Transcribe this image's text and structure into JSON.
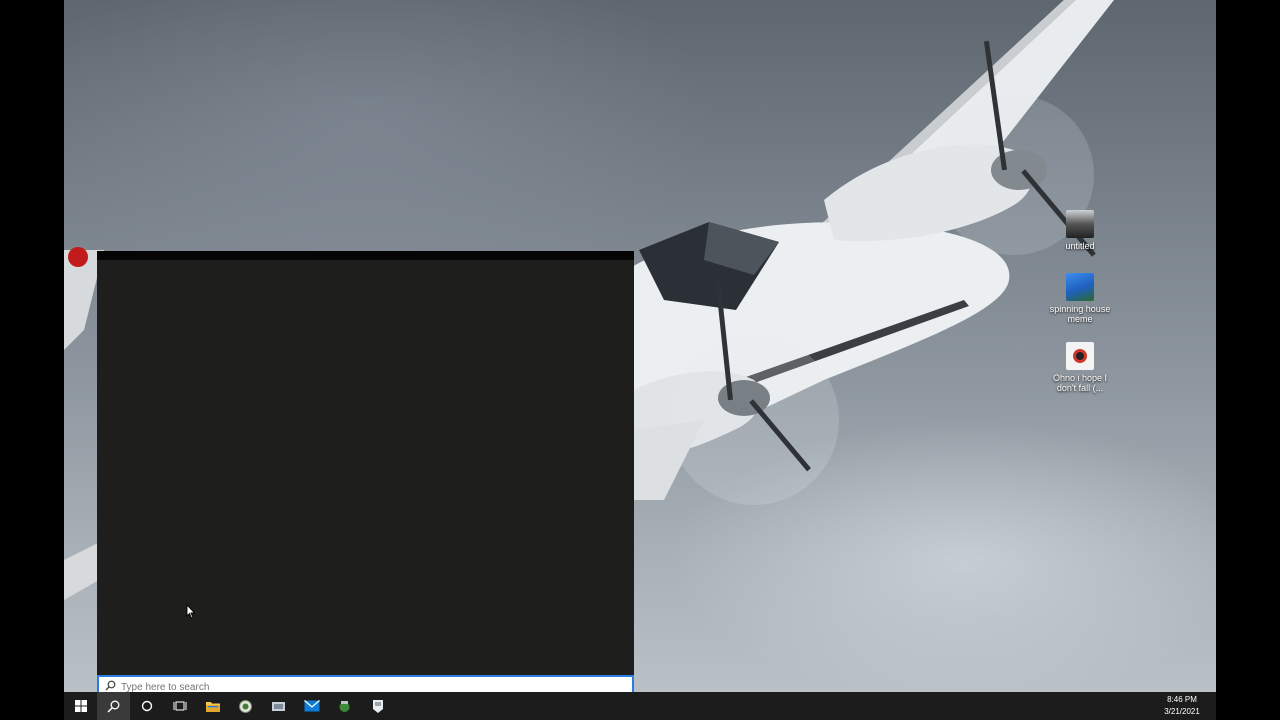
{
  "desktop": {
    "icons": [
      {
        "label": "untitled",
        "icon": "video-thumbnail-icon"
      },
      {
        "label": "spinning house meme",
        "icon": "image-thumbnail-icon"
      },
      {
        "label": "Ohno i hope I don't fall (...",
        "icon": "media-file-icon"
      }
    ]
  },
  "search": {
    "placeholder": "Type here to search",
    "value": ""
  },
  "taskbar": {
    "items": [
      "start-icon",
      "search-icon",
      "cortana-icon",
      "task-view-icon",
      "file-explorer-icon",
      "app-icon",
      "app-icon",
      "mail-icon",
      "app-icon",
      "app-icon"
    ],
    "time": "8:46 PM",
    "date": "3/21/2021"
  },
  "colors": {
    "start_panel": "#1e1e1c",
    "taskbar": "#1c1c1c",
    "accent": "#2a7de1"
  }
}
